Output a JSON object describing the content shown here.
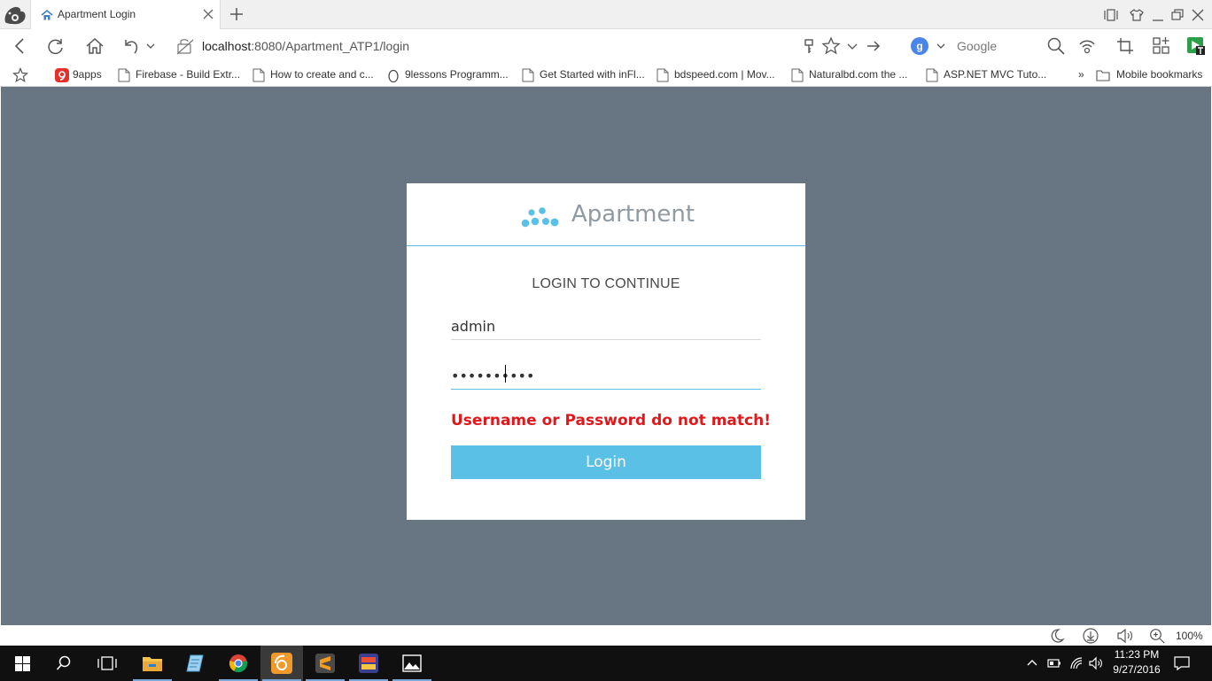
{
  "browser": {
    "tab": {
      "title": "Apartment Login",
      "favicon": "home-icon"
    },
    "address": {
      "host": "localhost",
      "path": ":8080/Apartment_ATP1/login"
    },
    "search": {
      "placeholder": "Google",
      "engine_letter": "g"
    },
    "bookmarks": [
      {
        "label": "9apps",
        "icon": "9apps-icon"
      },
      {
        "label": "Firebase - Build Extr...",
        "icon": "page-icon"
      },
      {
        "label": "How to create and c...",
        "icon": "page-icon"
      },
      {
        "label": "9lessons Programm...",
        "icon": "egg-icon"
      },
      {
        "label": "Get Started with inFl...",
        "icon": "page-icon"
      },
      {
        "label": "bdspeed.com | Mov...",
        "icon": "page-icon"
      },
      {
        "label": "Naturalbd.com the ...",
        "icon": "page-icon"
      },
      {
        "label": "ASP.NET MVC Tuto...",
        "icon": "page-icon"
      }
    ],
    "bookmarks_more": "»",
    "mobile_bookmarks": "Mobile bookmarks",
    "zoom": "100%"
  },
  "page": {
    "brand": "Apartment",
    "heading": "LOGIN TO CONTINUE",
    "username_value": "admin",
    "password_value": "••••••••••",
    "error": "Username or Password do not match!",
    "login_button": "Login",
    "colors": {
      "background": "#687582",
      "accent": "#5bc0e6",
      "error": "#e0181b"
    }
  },
  "taskbar": {
    "time": "11:23 PM",
    "date": "9/27/2016"
  }
}
